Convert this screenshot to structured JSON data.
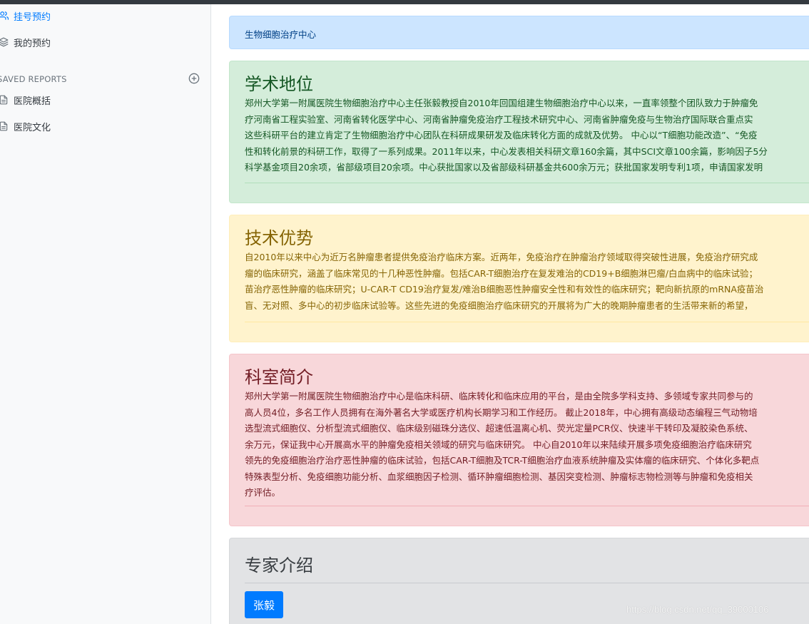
{
  "sidebar": {
    "items": [
      {
        "label": "挂号预约",
        "icon": "users-icon"
      },
      {
        "label": "我的预约",
        "icon": "layers-icon"
      }
    ],
    "reports_heading": "SAVED REPORTS",
    "reports": [
      {
        "label": "医院概括",
        "icon": "file-text-icon"
      },
      {
        "label": "医院文化",
        "icon": "file-text-icon"
      }
    ]
  },
  "main": {
    "banner": "生物细胞治疗中心",
    "sections": [
      {
        "title": "学术地位",
        "lines": [
          "郑州大学第一附属医院生物细胞治疗中心主任张毅教授自2010年回国组建生物细胞治疗中心以来，一直率领整个团队致力于肿瘤免",
          "疗河南省工程实验室、河南省转化医学中心、河南省肿瘤免疫治疗工程技术研究中心、河南省肿瘤免疫与生物治疗国际联合重点实",
          "这些科研平台的建立肯定了生物细胞治疗中心团队在科研成果研发及临床转化方面的成就及优势。 中心以“T细胞功能改造”、“免疫",
          "性和转化前景的科研工作，取得了一系列成果。2011年以来，中心发表相关科研文章160余篇，其中SCI文章100余篇，影响因子5分",
          "科学基金项目20余项，省部级项目20余项。中心获批国家以及省部级科研基金共600余万元；获批国家发明专利1项，申请国家发明"
        ]
      },
      {
        "title": "技术优势",
        "lines": [
          "自2010年以来中心为近万名肿瘤患者提供免疫治疗临床方案。近两年，免疫治疗在肿瘤治疗领域取得突破性进展，免疫治疗研究成",
          "瘤的临床研究，涵盖了临床常见的十几种恶性肿瘤。包括CAR-T细胞治疗在复发难治的CD19+B细胞淋巴瘤/白血病中的临床试验；",
          "苗治疗恶性肿瘤的临床研究；U-CAR-T CD19治疗复发/难治B细胞恶性肿瘤安全性和有效性的临床研究；靶向新抗原的mRNA疫苗治",
          "盲、无对照、多中心的初步临床试验等。这些先进的免疫细胞治疗临床研究的开展将为广大的晚期肿瘤患者的生活带来新的希望，"
        ]
      },
      {
        "title": "科室简介",
        "lines": [
          "郑州大学第一附属医院生物细胞治疗中心是临床科研、临床转化和临床应用的平台，是由全院多学科支持、多领域专家共同参与的",
          "高人员4位，多名工作人员拥有在海外著名大学或医疗机构长期学习和工作经历。 截止2018年，中心拥有高级动态编程三气动物培",
          "选型流式细胞仪、分析型流式细胞仪、临床级别磁珠分选仪、超速低温离心机、荧光定量PCR仪、快速半干转印及凝胶染色系统、",
          "余万元，保证我中心开展高水平的肿瘤免疫相关领域的研究与临床研究。 中心自2010年以来陆续开展多项免疫细胞治疗临床研究",
          "领先的免疫细胞治疗治疗恶性肿瘤的临床试验，包括CAR-T细胞及TCR-T细胞治疗血液系统肿瘤及实体瘤的临床研究、个体化多靶点",
          "特殊表型分析、免疫细胞功能分析、血浆细胞因子检测、循环肿瘤细胞检测、基因突变检测、肿瘤标志物检测等与肿瘤和免疫相关",
          "疗评估。"
        ]
      }
    ],
    "experts": {
      "title": "专家介绍",
      "button_label": "张毅"
    }
  },
  "watermark": "https://blog.csdn.net/qq_39000106"
}
